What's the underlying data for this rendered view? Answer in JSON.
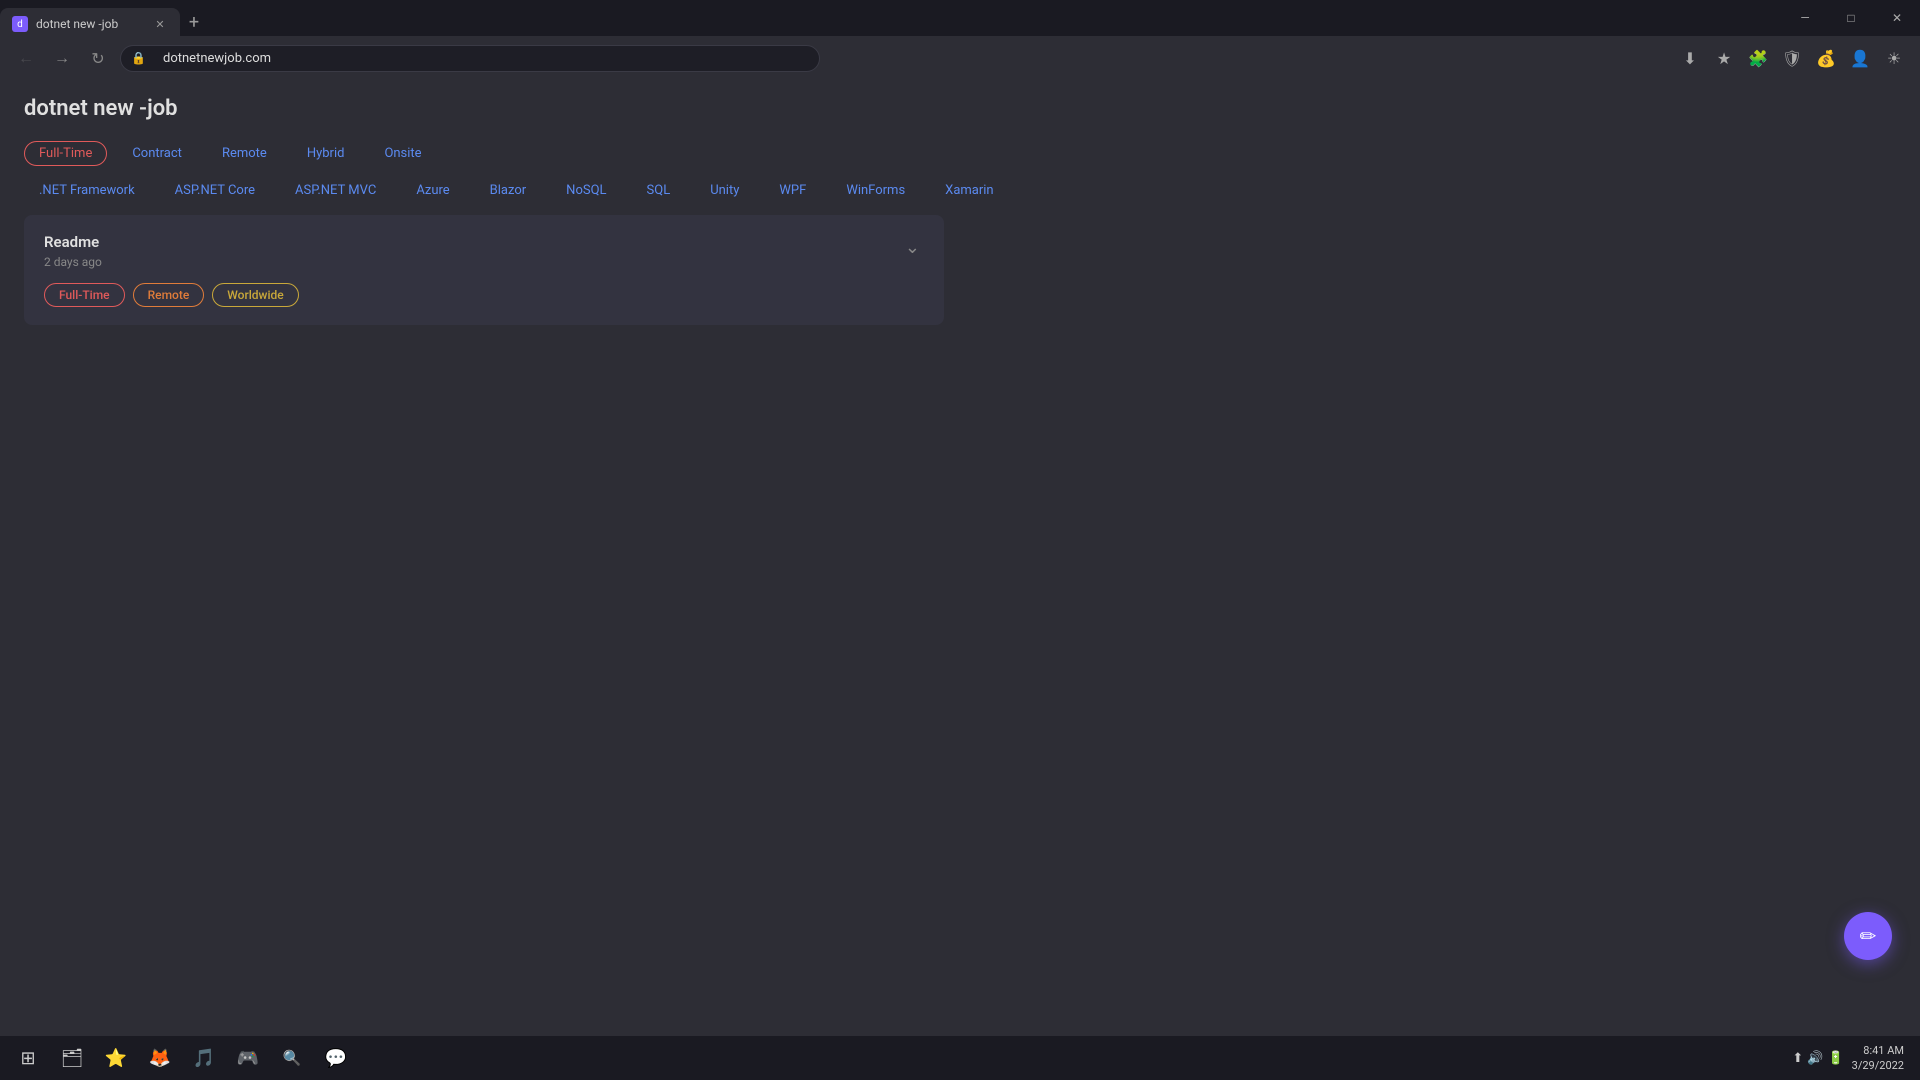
{
  "browser": {
    "tab_title": "dotnet new -job",
    "url": "dotnetnewjob.com",
    "favicon_letter": "d",
    "win_controls": {
      "minimize": "—",
      "maximize": "□",
      "close": "✕"
    }
  },
  "site": {
    "title": "dotnet new -job"
  },
  "filters": {
    "row1": [
      {
        "label": "Full-Time",
        "style": "active-red"
      },
      {
        "label": "Contract",
        "style": "active-blue"
      },
      {
        "label": "Remote",
        "style": "active-blue"
      },
      {
        "label": "Hybrid",
        "style": "active-blue"
      },
      {
        "label": "Onsite",
        "style": "active-blue"
      }
    ],
    "row2": [
      {
        "label": ".NET Framework"
      },
      {
        "label": "ASP.NET Core"
      },
      {
        "label": "ASP.NET MVC"
      },
      {
        "label": "Azure"
      },
      {
        "label": "Blazor"
      },
      {
        "label": "NoSQL"
      },
      {
        "label": "SQL"
      },
      {
        "label": "Unity"
      },
      {
        "label": "WPF"
      },
      {
        "label": "WinForms"
      },
      {
        "label": "Xamarin"
      }
    ]
  },
  "job_listing": {
    "title": "Readme",
    "time_ago": "2 days ago",
    "tags": [
      {
        "label": "Full-Time",
        "style": "job-tag-red"
      },
      {
        "label": "Remote",
        "style": "job-tag-orange"
      },
      {
        "label": "Worldwide",
        "style": "job-tag-gold"
      }
    ],
    "chevron": "⌄"
  },
  "chat_fab": {
    "icon": "✏"
  },
  "taskbar": {
    "start_icon": "⊞",
    "icons": [
      "🗂",
      "⭐",
      "🦊",
      "🎵",
      "🎮",
      "🔍",
      "💬"
    ],
    "system_icons": [
      "⬆",
      "🔊",
      "🔋"
    ],
    "time": "8:41 AM",
    "date": "3/29/2022"
  },
  "nav": {
    "back": "←",
    "forward": "→",
    "reload": "↻"
  }
}
